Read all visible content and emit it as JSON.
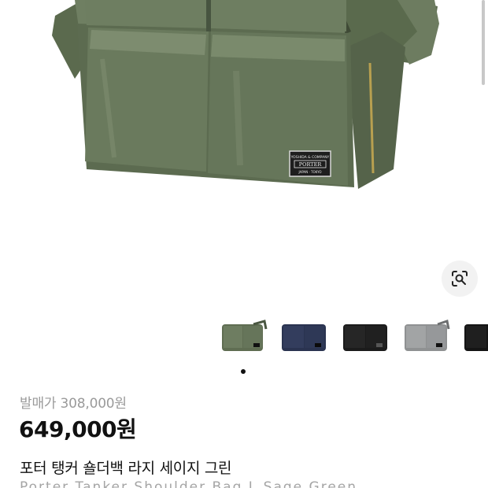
{
  "product": {
    "brand_label_line1": "YOSHIDA & COMPANY",
    "brand_label_logo": "PORTER",
    "brand_label_line2": "JAPAN · TOKYO"
  },
  "gallery": {
    "lens_icon": "visual-search-icon",
    "swatches": [
      {
        "color_name": "sage-green",
        "color": "#5f6d52"
      },
      {
        "color_name": "navy",
        "color": "#2a3350"
      },
      {
        "color_name": "black",
        "color": "#1b1b1b"
      },
      {
        "color_name": "silver-gray",
        "color": "#8f9192"
      },
      {
        "color_name": "black",
        "color": "#141414"
      }
    ],
    "page_indicator_active": 1
  },
  "pricing": {
    "original_label": "발매가 308,000원",
    "sale_price": "649,000원"
  },
  "title": {
    "korean": "포터 탱커 숄더백 라지 세이지 그린",
    "english": "Porter Tanker Shoulder Bag L Sage Green"
  },
  "colors": {
    "bag_main": "#66755a",
    "bag_dark": "#4a5741",
    "bag_highlight": "#7b8a6d"
  }
}
